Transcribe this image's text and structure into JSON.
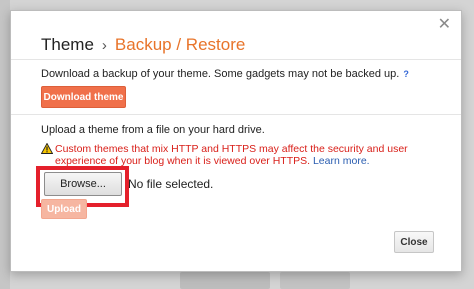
{
  "dialog": {
    "close_glyph": "✕",
    "breadcrumb": {
      "parent": "Theme",
      "separator": "›",
      "current": "Backup / Restore"
    },
    "download": {
      "description": "Download a backup of your theme. Some gadgets may not be backed up.",
      "help_label": "?",
      "button_label": "Download theme"
    },
    "upload": {
      "description": "Upload a theme from a file on your hard drive.",
      "warning_text": "Custom themes that mix HTTP and HTTPS may affect the security and user experience of your blog when it is viewed over HTTPS.",
      "learn_more": "Learn more.",
      "browse_label": "Browse...",
      "file_status": "No file selected.",
      "button_label": "Upload",
      "button_disabled": true
    },
    "close_button_label": "Close"
  },
  "colors": {
    "accent": "#e8742a",
    "button_orange": "#f0704a",
    "warning_red": "#d9201a",
    "highlight_red": "#e4202b",
    "link_blue": "#2a5db0"
  }
}
